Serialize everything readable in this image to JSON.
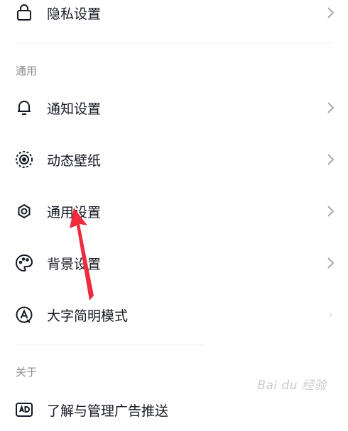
{
  "rows": {
    "privacy": {
      "label": "隐私设置"
    },
    "notify": {
      "label": "通知设置"
    },
    "wallpaper": {
      "label": "动态壁纸"
    },
    "general": {
      "label": "通用设置"
    },
    "background": {
      "label": "背景设置"
    },
    "largefont": {
      "label": "大字简明模式"
    },
    "ads": {
      "label": "了解与管理广告推送"
    }
  },
  "sections": {
    "general": "通用",
    "about": "关于"
  },
  "watermark": "Bai du 经验",
  "colors": {
    "text": "#161823",
    "section": "#8a8b91",
    "divider": "#ececee",
    "chevron": "#a8a9ad",
    "annotation_arrow": "#ee2b3c"
  },
  "icons": {
    "privacy": "lock-icon",
    "notify": "bell-icon",
    "wallpaper": "live-wallpaper-icon",
    "general": "gear-icon",
    "background": "palette-icon",
    "largefont": "large-font-icon",
    "ads": "ad-icon"
  }
}
